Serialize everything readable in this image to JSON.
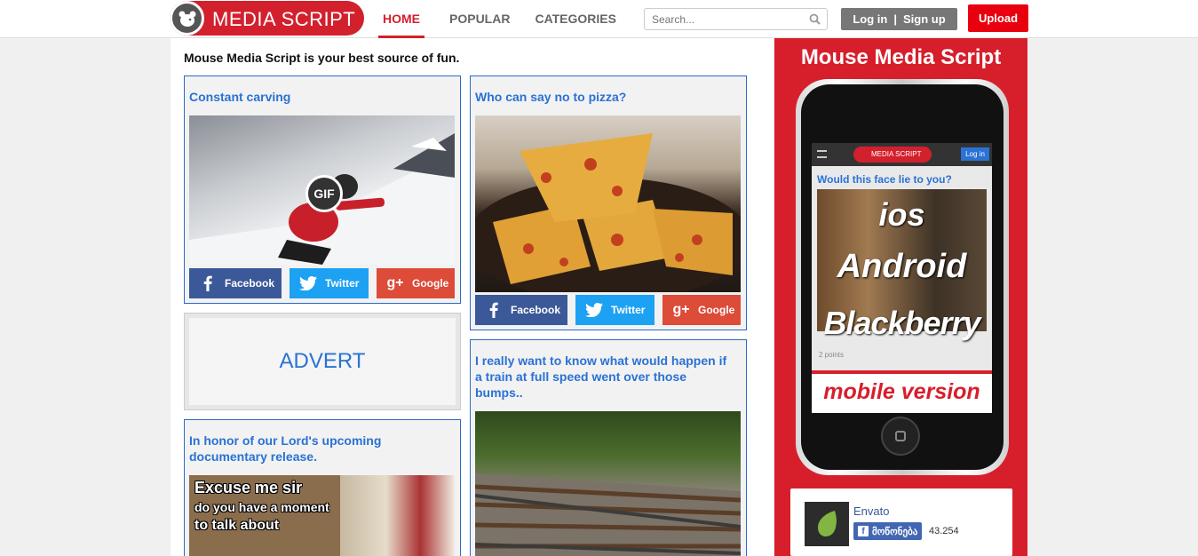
{
  "header": {
    "logo_text": "MEDIA SCRIPT",
    "nav": [
      {
        "label": "HOME",
        "active": true
      },
      {
        "label": "POPULAR",
        "active": false
      },
      {
        "label": "CATEGORIES",
        "active": false
      }
    ],
    "search_placeholder": "Search...",
    "login_label": "Log in",
    "separator": "|",
    "signup_label": "Sign up",
    "upload_label": "Upload"
  },
  "main": {
    "tagline": "Mouse Media Script is your best source of fun.",
    "posts": [
      {
        "title": "Constant carving",
        "badge": "GIF"
      },
      {
        "title": "Who can say no to pizza?"
      },
      {
        "title": "I really want to know what would happen if a train at full speed went over those bumps.."
      },
      {
        "title": "In honor of our Lord's upcoming documentary release.",
        "meme_text": [
          "Excuse me sir",
          "do you have a moment",
          "to talk about"
        ]
      }
    ],
    "share": {
      "facebook": "Facebook",
      "twitter": "Twitter",
      "google": "Google"
    },
    "advert_label": "ADVERT"
  },
  "sidebar": {
    "title": "Mouse Media Script",
    "phone": {
      "logo_text": "MEDIA SCRIPT",
      "login": "Log in",
      "post_title": "Would this face lie to you?",
      "points": "2 points",
      "overlay_lines": [
        "ios",
        "Android",
        "Blackberry"
      ],
      "caption": "mobile version"
    },
    "facebook_widget": {
      "page_name": "Envato",
      "like_label": "მოწონება",
      "count": "43.254"
    }
  },
  "colors": {
    "brand_red": "#d3202d",
    "link_blue": "#2a72d4",
    "facebook": "#3b5998",
    "twitter": "#1da1f2",
    "google": "#dd4b39"
  }
}
